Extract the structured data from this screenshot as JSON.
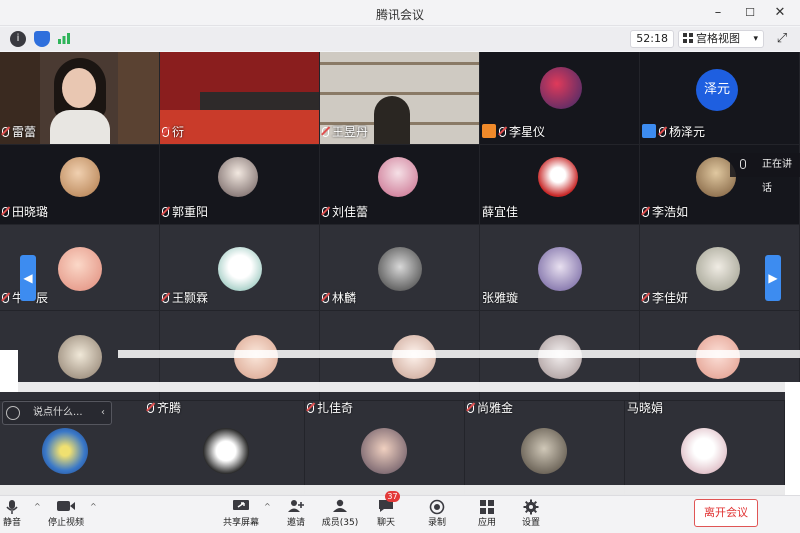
{
  "window": {
    "title": "腾讯会议",
    "minimize": "–",
    "maximize": "☐",
    "close": "✕"
  },
  "status": {
    "timer": "52:18",
    "view_mode": "宫格视图",
    "view_caret": "▾",
    "fullscreen": "⤢",
    "info_icon": "info-icon",
    "shield_icon": "shield-icon",
    "signal_icon": "signal-icon"
  },
  "speaking": {
    "label": "正在讲话"
  },
  "avatar_text": {
    "yangzeyuan": "泽元"
  },
  "participants": [
    {
      "name": "雷蕾"
    },
    {
      "name": "衍"
    },
    {
      "name": "王昱丹"
    },
    {
      "name": "李星仪"
    },
    {
      "name": "杨泽元"
    },
    {
      "name": "田晓璐"
    },
    {
      "name": "郭重阳"
    },
    {
      "name": "刘佳蕾"
    },
    {
      "name": "薛宜佳"
    },
    {
      "name": "李浩如"
    },
    {
      "name": "牛一辰"
    },
    {
      "name": "王颢霖"
    },
    {
      "name": "林麟"
    },
    {
      "name": "张雅璇"
    },
    {
      "name": "李佳妍"
    },
    {
      "name": "齐腾"
    },
    {
      "name": "扎佳奇"
    },
    {
      "name": "尚雅金"
    },
    {
      "name": "马晓娟"
    }
  ],
  "chat": {
    "placeholder": "说点什么...",
    "chevron": "‹"
  },
  "nav": {
    "left": "◀",
    "right": "▶"
  },
  "toolbar": {
    "mute": "静音",
    "stop_video": "停止视频",
    "share_screen": "共享屏幕",
    "invite": "邀请",
    "members": "成员(35)",
    "chat": "聊天",
    "chat_count": "37",
    "record": "录制",
    "apps": "应用",
    "settings": "设置",
    "leave": "离开会议",
    "caret": "^"
  },
  "colors": {
    "accent": "#3d8cf0",
    "leave": "#e03030",
    "grid_bg": "#2b2c33"
  }
}
